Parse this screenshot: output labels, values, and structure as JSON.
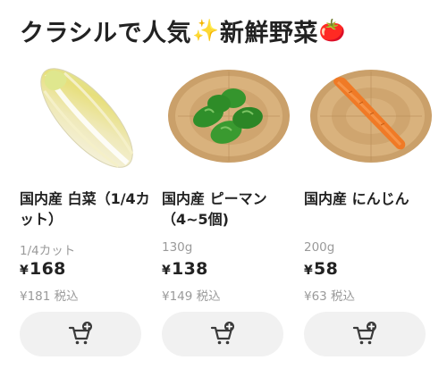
{
  "header": {
    "title_part1": "クラシルで人気",
    "sparkle_emoji": "✨",
    "title_part2": "新鮮野菜",
    "tomato_emoji": "🍅"
  },
  "products": [
    {
      "name": "国内産 白菜（1/4カット）",
      "unit": "1/4カット",
      "yen_symbol": "¥",
      "price": "168",
      "tax_included": "¥181 税込",
      "image_icon": "napa-cabbage-image",
      "cart_icon": "cart-add-icon"
    },
    {
      "name": "国内産 ピーマン（4~5個)",
      "unit": "130g",
      "yen_symbol": "¥",
      "price": "138",
      "tax_included": "¥149 税込",
      "image_icon": "green-pepper-image",
      "cart_icon": "cart-add-icon"
    },
    {
      "name": "国内産 にんじん",
      "unit": "200g",
      "yen_symbol": "¥",
      "price": "58",
      "tax_included": "¥63 税込",
      "image_icon": "carrot-image",
      "cart_icon": "cart-add-icon"
    }
  ],
  "colors": {
    "text": "#222222",
    "muted": "#9a9a9a",
    "button_bg": "#f1f1f1",
    "icon": "#3a3a3a"
  }
}
